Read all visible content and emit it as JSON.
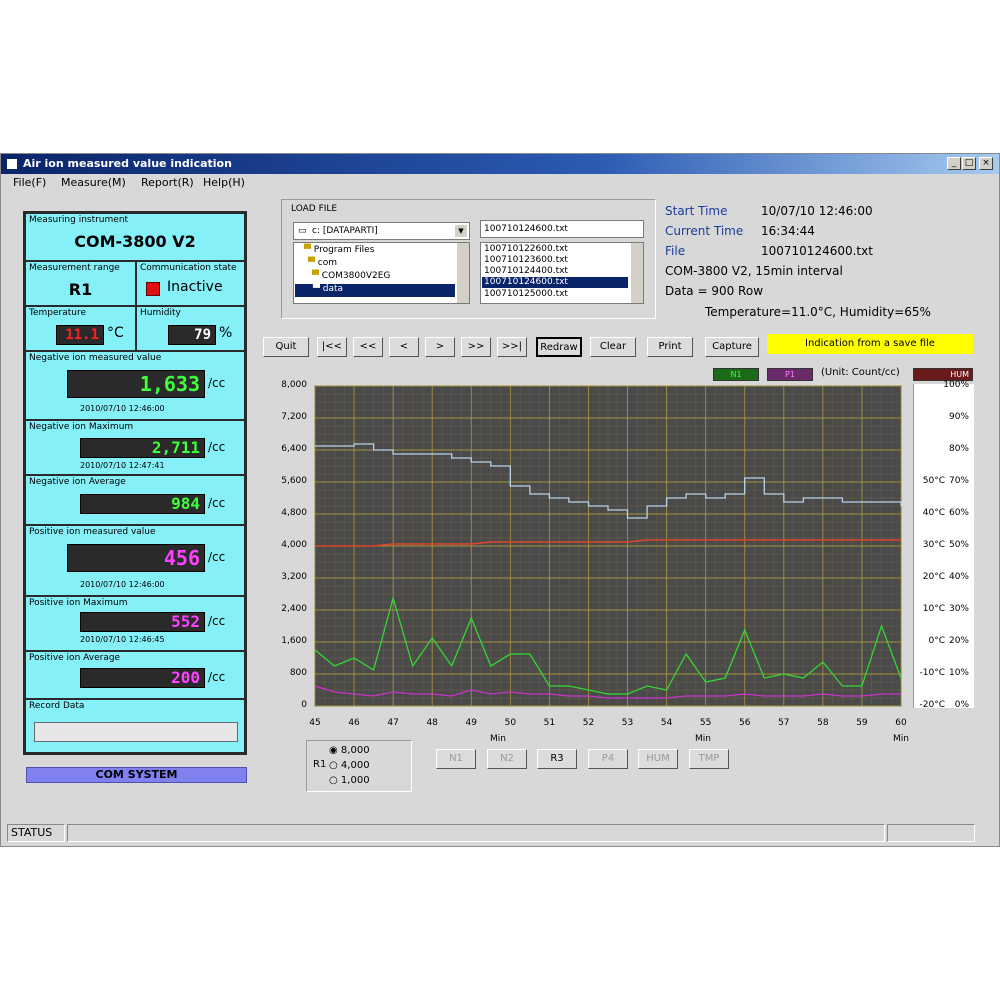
{
  "window": {
    "title": "Air ion measured value indication",
    "controls": [
      "_",
      "□",
      "×"
    ]
  },
  "menu": [
    "File(F)",
    "Measure(M)",
    "Report(R)",
    "Help(H)"
  ],
  "meter": {
    "instrument_label": "Measuring instrument",
    "instrument": "COM-3800 V2",
    "range_label": "Measurement range",
    "range": "R1",
    "comm_label": "Communication state",
    "comm_status": "Inactive",
    "temp_label": "Temperature",
    "temp_value": "11.1",
    "temp_unit": "°C",
    "hum_label": "Humidity",
    "hum_value": "79",
    "hum_unit": "%",
    "neg_measured_label": "Negative ion measured value",
    "neg_measured": "1,633",
    "neg_measured_unit": "/cc",
    "neg_measured_time": "2010/07/10 12:46:00",
    "neg_max_label": "Negative ion Maximum",
    "neg_max": "2,711",
    "neg_max_unit": "/cc",
    "neg_max_time": "2010/07/10 12:47:41",
    "neg_avg_label": "Negative ion Average",
    "neg_avg": "984",
    "neg_avg_unit": "/cc",
    "pos_measured_label": "Positive ion measured value",
    "pos_measured": "456",
    "pos_measured_unit": "/cc",
    "pos_measured_time": "2010/07/10 12:46:00",
    "pos_max_label": "Positive ion Maximum",
    "pos_max": "552",
    "pos_max_unit": "/cc",
    "pos_max_time": "2010/07/10 12:46:45",
    "pos_avg_label": "Positive ion Average",
    "pos_avg": "200",
    "pos_avg_unit": "/cc",
    "record_label": "Record Data",
    "system_label": "COM SYSTEM"
  },
  "load_file": {
    "label": "LOAD FILE",
    "drive": "c: [DATAPARTI]",
    "folders": [
      "Program Files",
      "com",
      "COM3800V2EG",
      "data"
    ],
    "file_input": "100710124600.txt",
    "files": [
      "100710122600.txt",
      "100710123600.txt",
      "100710124400.txt",
      "100710124600.txt",
      "100710125000.txt"
    ]
  },
  "info": {
    "start_label": "Start Time",
    "start_value": "10/07/10 12:46:00",
    "current_label": "Current Time",
    "current_value": "16:34:44",
    "file_label": "File",
    "file_value": "100710124600.txt",
    "device_line": "COM-3800 V2, 15min interval",
    "data_line": "Data = 900 Row",
    "env_line": "Temperature=11.0°C, Humidity=65%"
  },
  "toolbar": {
    "quit": "Quit",
    "first": "|<<",
    "prev_page": "<<",
    "prev": "<",
    "next": ">",
    "next_page": ">>",
    "last": ">>|",
    "redraw": "Redraw",
    "clear": "Clear",
    "print": "Print",
    "capture": "Capture",
    "indication": "Indication from a save file"
  },
  "legend": {
    "neg": "N1",
    "pos": "P1",
    "unit": "(Unit: Count/cc)",
    "temp": "HUM"
  },
  "colors": {
    "plot_bg": "#4a4a4a",
    "grid": "#b09a3c",
    "neg": "#34d634",
    "pos": "#cc33cc",
    "temp": "#e0452a",
    "hum": "#b8d4e8",
    "indication": "#ffff00"
  },
  "chart_data": {
    "type": "line",
    "xlabel": "Min",
    "xlim": [
      45,
      60
    ],
    "ylim": [
      0,
      8000
    ],
    "x_ticks": [
      "45",
      "46",
      "47",
      "48",
      "49",
      "50",
      "51",
      "52",
      "53",
      "54",
      "55",
      "56",
      "57",
      "58",
      "59",
      "60"
    ],
    "y_ticks": [
      "8,000",
      "7,200",
      "6,400",
      "5,600",
      "4,800",
      "4,000",
      "3,200",
      "2,400",
      "1,600",
      "800",
      "0"
    ],
    "right_ticks_a": [
      "100%",
      "90%",
      "80%",
      "70%",
      "60%",
      "50%",
      "40%",
      "30%",
      "20%",
      "10%",
      "0%"
    ],
    "right_ticks_b": [
      "",
      "",
      "",
      "50°C",
      "40°C",
      "30°C",
      "20°C",
      "10°C",
      "0°C",
      "-10°C",
      "-20°C"
    ],
    "x": [
      45,
      45.5,
      46,
      46.5,
      47,
      47.5,
      48,
      48.5,
      49,
      49.5,
      50,
      50.5,
      51,
      51.5,
      52,
      52.5,
      53,
      53.5,
      54,
      54.5,
      55,
      55.5,
      56,
      56.5,
      57,
      57.5,
      58,
      58.5,
      59,
      59.5,
      60
    ],
    "series": [
      {
        "name": "N1",
        "values": [
          1400,
          1000,
          1200,
          900,
          2700,
          1000,
          1700,
          1000,
          2200,
          1000,
          1300,
          1300,
          500,
          500,
          400,
          300,
          300,
          500,
          400,
          1300,
          600,
          700,
          1900,
          700,
          800,
          700,
          1100,
          500,
          500,
          2000,
          700
        ]
      },
      {
        "name": "P1",
        "values": [
          500,
          350,
          300,
          250,
          350,
          300,
          300,
          250,
          400,
          300,
          350,
          300,
          300,
          250,
          250,
          200,
          200,
          200,
          200,
          250,
          250,
          250,
          300,
          250,
          250,
          250,
          300,
          250,
          250,
          300,
          300
        ]
      },
      {
        "name": "Temperature",
        "values": [
          4000,
          4000,
          4000,
          4000,
          4050,
          4050,
          4050,
          4050,
          4050,
          4100,
          4100,
          4100,
          4100,
          4100,
          4100,
          4100,
          4100,
          4150,
          4150,
          4150,
          4150,
          4150,
          4150,
          4150,
          4150,
          4150,
          4150,
          4150,
          4150,
          4150,
          4150
        ]
      },
      {
        "name": "Humidity",
        "values": [
          6500,
          6500,
          6550,
          6400,
          6300,
          6300,
          6300,
          6200,
          6100,
          6000,
          5500,
          5300,
          5200,
          5100,
          5000,
          4900,
          4700,
          5000,
          5200,
          5300,
          5200,
          5300,
          5700,
          5300,
          5100,
          5200,
          5200,
          5100,
          5100,
          5100,
          5000
        ]
      }
    ]
  },
  "range_select": {
    "label": "R1",
    "options": [
      "8,000",
      "4,000",
      "1,000"
    ],
    "selected": 0
  },
  "bottom_buttons": [
    "N1",
    "N2",
    "R3",
    "P4",
    "HUM",
    "TMP"
  ],
  "status": {
    "label": "STATUS"
  }
}
